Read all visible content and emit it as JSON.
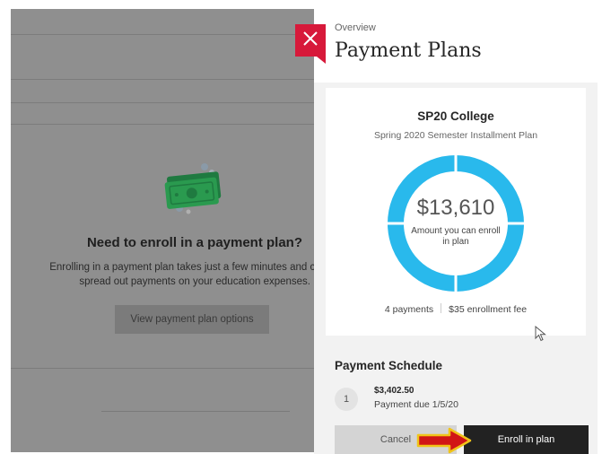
{
  "background": {
    "heading": "Need to enroll in a payment plan?",
    "description_line1": "Enrolling in a payment plan takes just a few minutes and can",
    "description_line2": "spread out payments on your education expenses.",
    "options_button_label": "View payment plan options",
    "illustration_icon": "money-bills-icon"
  },
  "panel": {
    "eyebrow": "Overview",
    "title": "Payment Plans",
    "close_icon": "close-icon",
    "accent_color": "#d7193a",
    "plan": {
      "name": "SP20 College",
      "subtitle": "Spring 2020 Semester Installment Plan",
      "amount": "$13,610",
      "amount_label": "Amount you can enroll in plan",
      "payments": "4 payments",
      "fee": "$35 enrollment fee",
      "ring_color": "#29b9ec",
      "ring_segments": 4
    },
    "schedule": {
      "heading": "Payment Schedule",
      "items": [
        {
          "number": "1",
          "amount": "$3,402.50",
          "due": "Payment due 1/5/20"
        }
      ]
    },
    "footer": {
      "cancel_label": "Cancel",
      "enroll_label": "Enroll in plan"
    }
  },
  "annotation": {
    "arrow_icon": "arrow-right-icon",
    "arrow_color": "#d11616",
    "arrow_outline": "#f0c419"
  },
  "cursor_icon": "mouse-pointer-icon"
}
